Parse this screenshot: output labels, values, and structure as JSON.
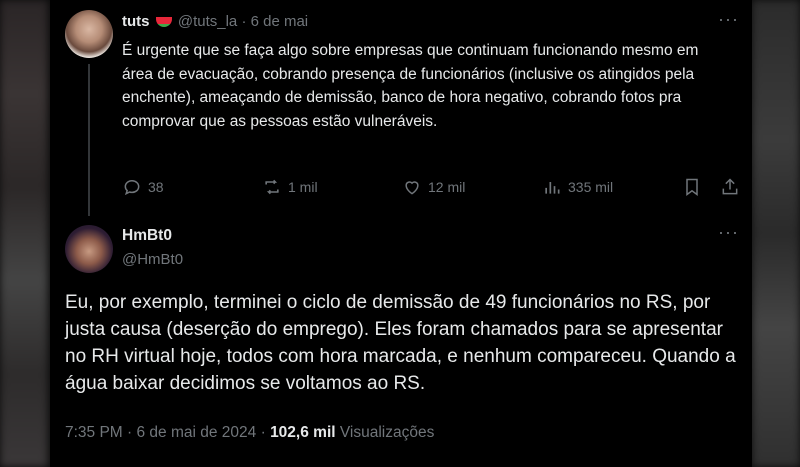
{
  "quoted_tweet": {
    "display_name": "tuts",
    "name_emoji": "watermelon-emoji",
    "handle": "@tuts_la",
    "separator": "·",
    "date": "6 de mai",
    "text": "É urgente que se faça algo sobre empresas que continuam funcionando mesmo em área de evacuação, cobrando presença de funcionários (inclusive os atingidos pela enchente), ameaçando de demissão, banco de hora negativo, cobrando fotos pra comprovar que as pessoas estão vulneráveis.",
    "replies": "38",
    "retweets": "1 mil",
    "likes": "12 mil",
    "views": "335 mil",
    "more_glyph": "···"
  },
  "main_tweet": {
    "display_name": "HmBt0",
    "handle": "@HmBt0",
    "text": "Eu, por exemplo, terminei o ciclo de demissão de 49 funcionários no RS, por justa causa (deserção do emprego). Eles foram chamados para se apresentar no RH virtual hoje, todos com hora marcada, e nenhum compareceu. Quando a água baixar decidimos se voltamos ao RS.",
    "timestamp": "7:35 PM · 6 de mai de 2024 · ",
    "views_count": "102,6 mil",
    "views_label": " Visualizações",
    "more_glyph": "···"
  },
  "colors": {
    "background": "#000000",
    "text": "#e7e9ea",
    "muted": "#71767b",
    "thread_line": "#333639"
  }
}
